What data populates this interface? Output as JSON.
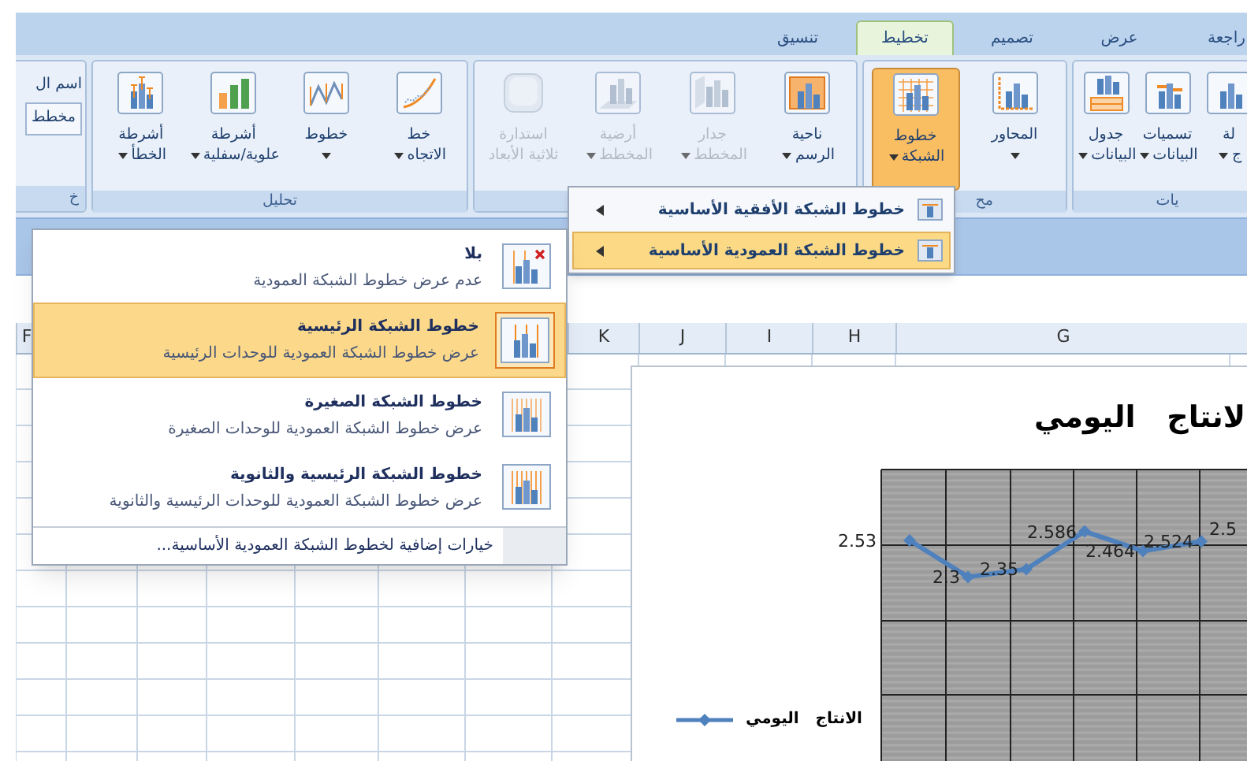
{
  "tabs": [
    {
      "label": "راجعة",
      "selected": false
    },
    {
      "label": "عرض",
      "selected": false
    },
    {
      "label": "تصميم",
      "selected": false
    },
    {
      "label": "تخطيط",
      "selected": true
    },
    {
      "label": "تنسيق",
      "selected": false
    }
  ],
  "ribbon_groups": [
    {
      "label": "يات",
      "buttons": [
        {
          "kind": "bars",
          "lines": [
            "لة",
            "ج"
          ],
          "dropdown": true,
          "disabled": false,
          "active": false
        },
        {
          "kind": "datalabels",
          "lines": [
            "تسميات",
            "البيانات"
          ],
          "dropdown": true,
          "disabled": false,
          "active": false
        },
        {
          "kind": "datatable",
          "lines": [
            "جدول",
            "البيانات"
          ],
          "dropdown": true,
          "disabled": false,
          "active": false
        }
      ]
    },
    {
      "label": "مح",
      "buttons": [
        {
          "kind": "axes",
          "lines": [
            "المحاور"
          ],
          "dropdown": true,
          "disabled": false,
          "active": false
        },
        {
          "kind": "gridlines",
          "lines": [
            "خطوط",
            "الشبكة"
          ],
          "dropdown": true,
          "disabled": false,
          "active": true
        }
      ]
    },
    {
      "buttons": [
        {
          "kind": "plotarea",
          "lines": [
            "ناحية",
            "الرسم"
          ],
          "dropdown": true,
          "disabled": false,
          "active": false
        },
        {
          "kind": "wall",
          "lines": [
            "جدار",
            "المخطط"
          ],
          "dropdown": true,
          "disabled": true,
          "active": false
        },
        {
          "kind": "floor",
          "lines": [
            "أرضية",
            "المخطط"
          ],
          "dropdown": true,
          "disabled": true,
          "active": false
        },
        {
          "kind": "cube",
          "lines": [
            "استدارة",
            "ثلاثية الأبعاد"
          ],
          "dropdown": false,
          "disabled": true,
          "active": false
        }
      ]
    },
    {
      "label": "تحليل",
      "buttons": [
        {
          "kind": "trendline",
          "lines": [
            "خط",
            "الاتجاه"
          ],
          "dropdown": true,
          "disabled": false,
          "active": false
        },
        {
          "kind": "lines",
          "lines": [
            "خطوط"
          ],
          "dropdown": true,
          "disabled": false,
          "active": false
        },
        {
          "kind": "updown",
          "lines": [
            "أشرطة",
            "علوية/سفلية"
          ],
          "dropdown": true,
          "disabled": false,
          "active": false
        },
        {
          "kind": "errorbars",
          "lines": [
            "أشرطة",
            "الخطأ"
          ],
          "dropdown": true,
          "disabled": false,
          "active": false
        }
      ]
    }
  ],
  "partial_group": {
    "caption": "اسم ال",
    "field_value": "مخطط",
    "label": "خ"
  },
  "column_headers": [
    "G",
    "H",
    "I",
    "J",
    "K",
    "F"
  ],
  "submenu": [
    {
      "label": "خطوط الشبكة الأفقية الأساسية",
      "selected": false
    },
    {
      "label": "خطوط الشبكة العمودية الأساسية",
      "selected": true
    }
  ],
  "dropdown": {
    "items": [
      {
        "kind": "none",
        "title": "بلا",
        "description": "عدم عرض خطوط الشبكة العمودية",
        "selected": false
      },
      {
        "kind": "major",
        "title": "خطوط الشبكة الرئيسية",
        "description": "عرض خطوط الشبكة العمودية للوحدات الرئيسية",
        "selected": true
      },
      {
        "kind": "minor",
        "title": "خطوط الشبكة الصغيرة",
        "description": "عرض خطوط الشبكة العمودية للوحدات الصغيرة",
        "selected": false
      },
      {
        "kind": "both",
        "title": "خطوط الشبكة الرئيسية والثانوية",
        "description": "عرض خطوط الشبكة العمودية للوحدات الرئيسية والثانوية",
        "selected": false
      }
    ],
    "footer": "خيارات إضافية لخطوط الشبكة العمودية الأساسية..."
  },
  "chart": {
    "chart_data": {
      "type": "line",
      "title": "لانتاج   اليومي",
      "series": [
        {
          "name": "الانتاج   اليومي",
          "color": "#4f81bd",
          "marker": "diamond",
          "values": [
            2.53,
            2.3,
            2.35,
            2.586,
            2.464,
            2.524
          ]
        }
      ],
      "data_labels": true
    },
    "cut_label": "2.5"
  }
}
